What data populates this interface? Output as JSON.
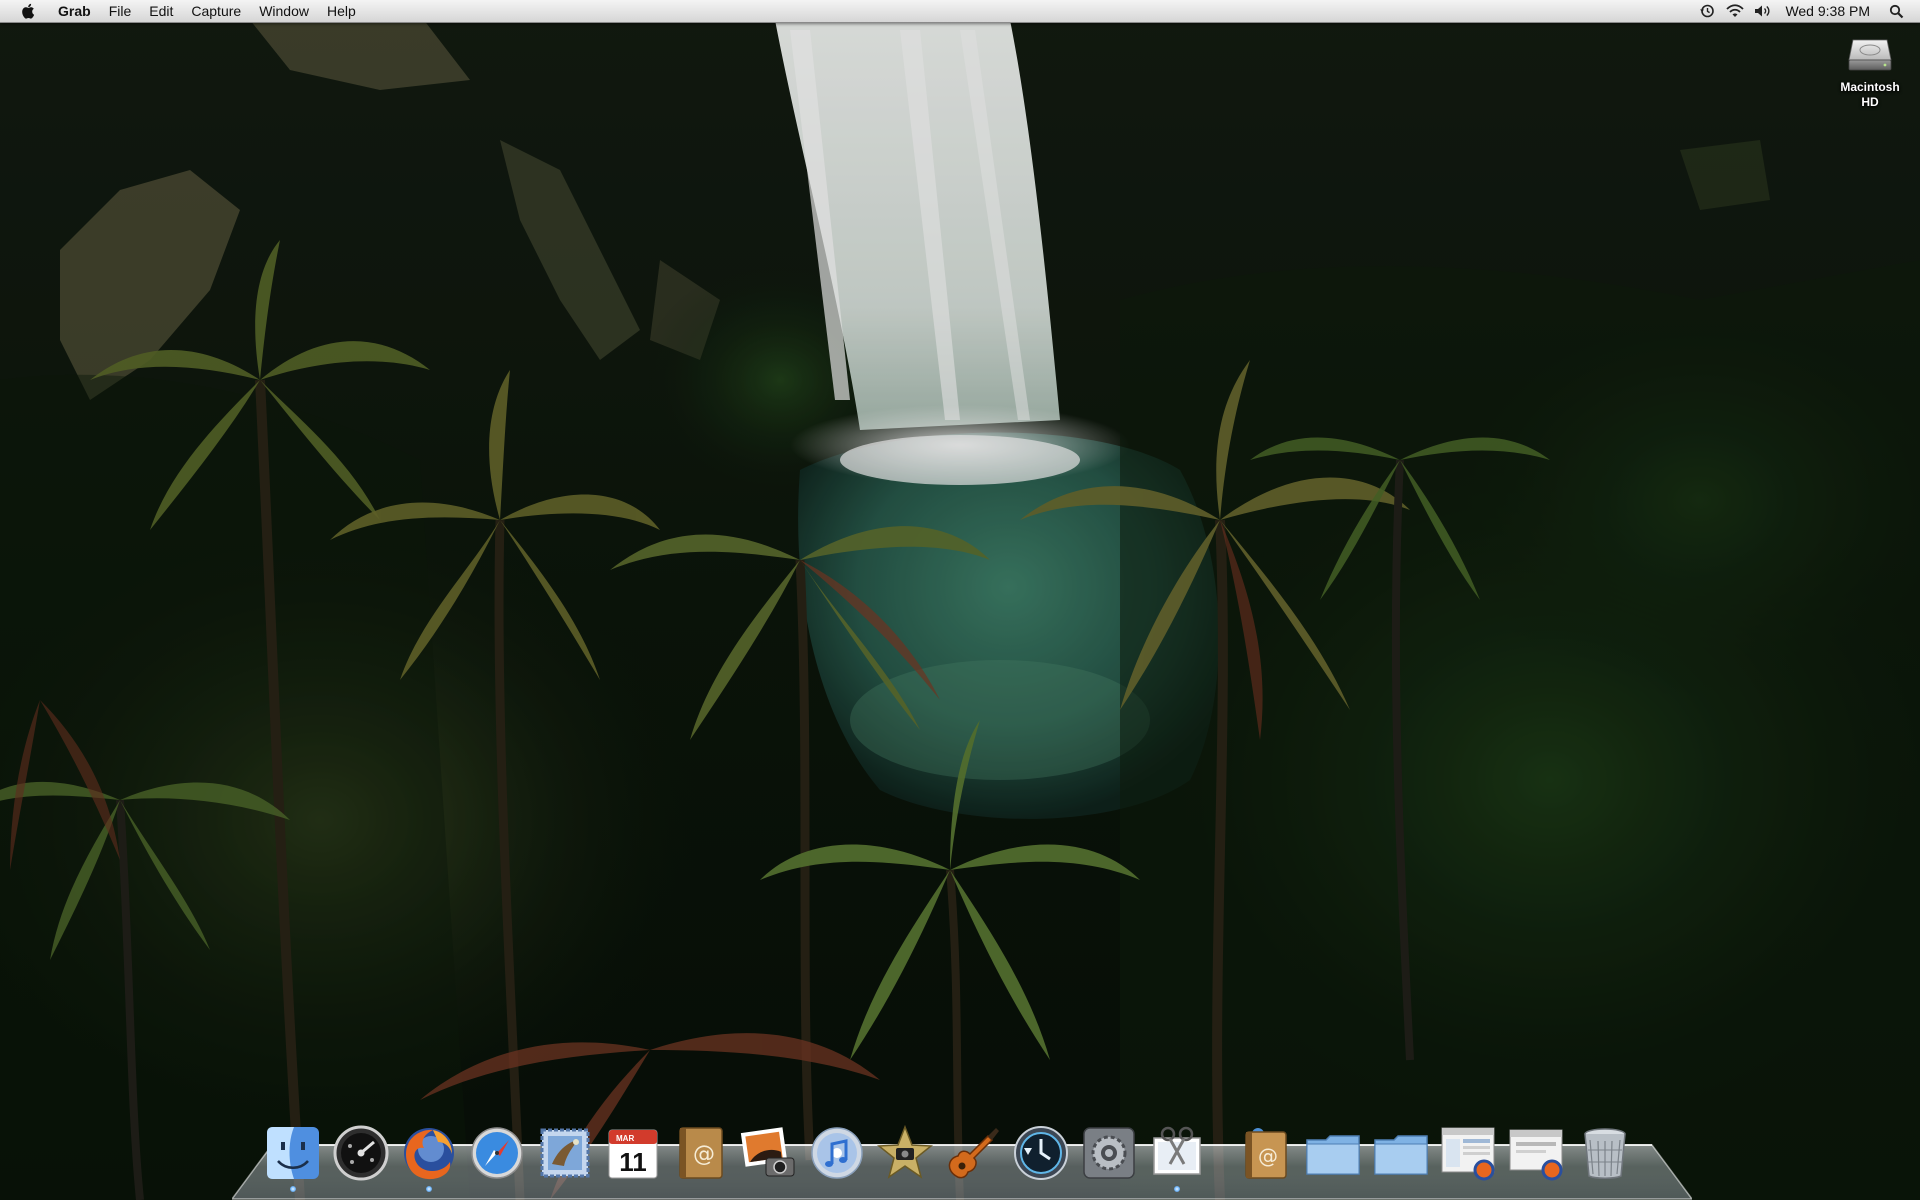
{
  "menubar": {
    "app_name": "Grab",
    "menus": [
      "File",
      "Edit",
      "Capture",
      "Window",
      "Help"
    ],
    "clock": "Wed 9:38 PM",
    "status_icons": [
      "time-machine-icon",
      "wifi-icon",
      "volume-icon",
      "spotlight-icon"
    ]
  },
  "desktop": {
    "volume_line1": "Macintosh",
    "volume_line2": "HD"
  },
  "dock": {
    "apps": [
      {
        "name": "finder-icon",
        "running": true
      },
      {
        "name": "dashboard-icon",
        "running": false
      },
      {
        "name": "firefox-icon",
        "running": true
      },
      {
        "name": "safari-icon",
        "running": false
      },
      {
        "name": "mail-icon",
        "running": false
      },
      {
        "name": "ical-icon",
        "running": false,
        "calendar_month": "MAR",
        "calendar_day": "11"
      },
      {
        "name": "address-book-icon",
        "running": false
      },
      {
        "name": "iphoto-icon",
        "running": false
      },
      {
        "name": "itunes-icon",
        "running": false
      },
      {
        "name": "imovie-icon",
        "running": false
      },
      {
        "name": "garageband-icon",
        "running": false
      },
      {
        "name": "time-machine-icon",
        "running": false
      },
      {
        "name": "system-preferences-icon",
        "running": false
      },
      {
        "name": "grab-icon",
        "running": true
      }
    ],
    "stacks": [
      {
        "name": "address-book-stack-icon"
      },
      {
        "name": "applications-folder-icon"
      },
      {
        "name": "documents-folder-icon"
      },
      {
        "name": "firefox-window-minimized-1"
      },
      {
        "name": "firefox-window-minimized-2"
      },
      {
        "name": "trash-icon"
      }
    ]
  },
  "colors": {
    "menubar_top": "#f4f4f4",
    "menubar_bottom": "#d6d6d6",
    "wallpaper_dark": "#0d1a0c",
    "water": "#2f6a55",
    "dock_glow": "#6fb7ff"
  }
}
